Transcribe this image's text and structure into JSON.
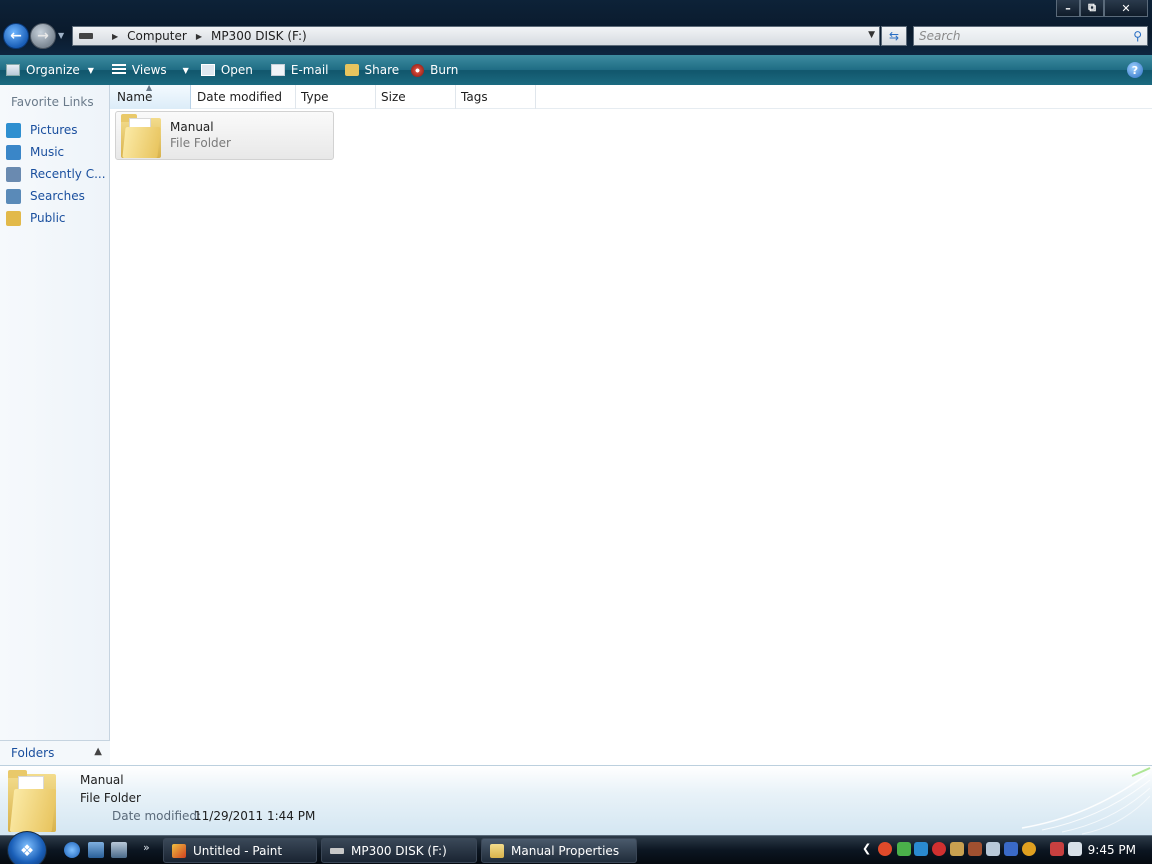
{
  "window": {
    "minimize_glyph": "–",
    "maximize_glyph": "⧉",
    "close_glyph": "✕"
  },
  "address": {
    "crumbs": [
      "Computer",
      "MP300 DISK (F:)"
    ],
    "search_placeholder": "Search"
  },
  "toolbar": {
    "organize": "Organize",
    "views": "Views",
    "open": "Open",
    "email": "E-mail",
    "share": "Share",
    "burn": "Burn"
  },
  "nav": {
    "title": "Favorite Links",
    "items": [
      {
        "label": "Pictures",
        "icon": "pictures-icon",
        "color": "#2e8fd0"
      },
      {
        "label": "Music",
        "icon": "music-icon",
        "color": "#3a86c8"
      },
      {
        "label": "Recently C...",
        "icon": "recent-places-icon",
        "color": "#6a8ab0"
      },
      {
        "label": "Searches",
        "icon": "saved-search-icon",
        "color": "#5a8ab8"
      },
      {
        "label": "Public",
        "icon": "public-folder-icon",
        "color": "#e2b94a"
      }
    ],
    "folders_label": "Folders"
  },
  "columns": [
    "Name",
    "Date modified",
    "Type",
    "Size",
    "Tags"
  ],
  "files": [
    {
      "name": "Manual",
      "type": "File Folder"
    }
  ],
  "details": {
    "name": "Manual",
    "type": "File Folder",
    "modified_label": "Date modified:",
    "modified_value": "11/29/2011 1:44 PM"
  },
  "taskbar": {
    "tasks": [
      "Untitled - Paint",
      "MP300 DISK (F:)",
      "Manual Properties"
    ],
    "clock": "9:45 PM"
  },
  "colors": {
    "link": "#1a4f9e",
    "toolbar": "#1f6c84",
    "folder": "#e8c45e"
  }
}
